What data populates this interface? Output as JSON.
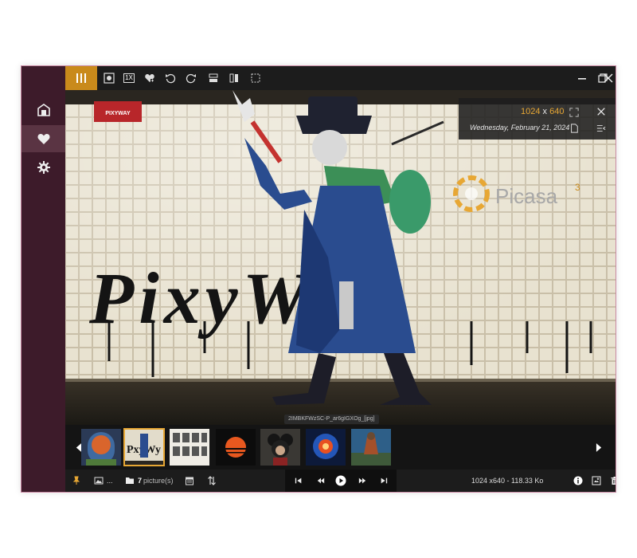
{
  "sidebar": {
    "items": [
      {
        "name": "folders",
        "icon": "folder-home-icon"
      },
      {
        "name": "favorites",
        "icon": "heart-icon",
        "active": true
      },
      {
        "name": "settings",
        "icon": "gear-icon"
      }
    ]
  },
  "toolbar": {
    "actual_size_label": "1X",
    "icons": [
      "menu-icon",
      "focus-icon",
      "actual-size-icon",
      "favorite-icon",
      "rotate-left-icon",
      "rotate-right-icon",
      "flip-vertical-icon",
      "flip-horizontal-icon",
      "crop-icon",
      "minimize-icon",
      "restore-icon",
      "close-icon"
    ]
  },
  "photo": {
    "wall_text": "PixyWay",
    "sign_text": "PIXYWAY",
    "watermark_text": "Picasa",
    "watermark_superscript": "3"
  },
  "info": {
    "width": "1024",
    "separator": "x",
    "height": "640",
    "date": "Wednesday, February 21, 2024"
  },
  "filename": "2IMBKFWzSC-P_ar6gIGXOg_[jpg]",
  "thumbnails": [
    {
      "name": "fantasy-tree-arch",
      "selected": false
    },
    {
      "name": "pixyway-graffiti",
      "selected": true
    },
    {
      "name": "sketch-collage",
      "selected": false
    },
    {
      "name": "sunset-circle",
      "selected": false
    },
    {
      "name": "dark-mouse-character",
      "selected": false
    },
    {
      "name": "glowing-portal",
      "selected": false
    },
    {
      "name": "armored-warrior",
      "selected": false
    }
  ],
  "status": {
    "folder_ellipsis": "...",
    "picture_count": "7",
    "picture_label": "picture(s)",
    "image_info": "1024 x640  -  118.33 Ko"
  },
  "colors": {
    "accent": "#e7a734",
    "sidebar_bg": "#3d1b2a",
    "sidebar_active": "#5a3443",
    "menu_button": "#c98a1b",
    "window_border": "#c98aa4"
  }
}
